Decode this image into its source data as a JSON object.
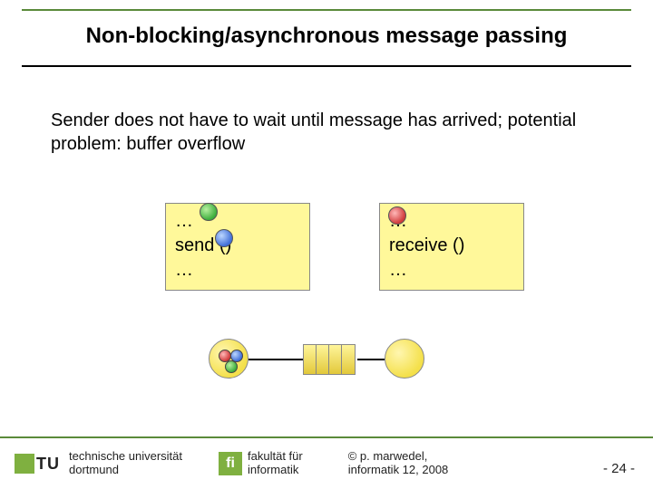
{
  "title": "Non-blocking/asynchronous message passing",
  "body": "Sender does not have to wait until message has arrived; potential problem: buffer overflow",
  "sender_box": {
    "line1": "…",
    "line2": "send ()",
    "line3": "…"
  },
  "receiver_box": {
    "line1": "…",
    "line2": "receive ()",
    "line3": "…"
  },
  "footer": {
    "tu": "TU",
    "university_line1": "technische universität",
    "university_line2": "dortmund",
    "fi_badge": "fi",
    "faculty_line1": "fakultät für",
    "faculty_line2": "informatik",
    "copyright_line1": "©  p. marwedel,",
    "copyright_line2": "informatik 12,  2008",
    "page": "-  24 -"
  }
}
